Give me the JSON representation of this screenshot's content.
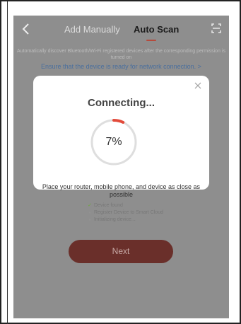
{
  "header": {
    "back_icon": "chevron-left",
    "tab_manual": "Add Manually",
    "tab_auto": "Auto Scan",
    "scan_icon": "scan-frame"
  },
  "main": {
    "description": "Automatically discover Bluetooth/Wi-Fi registered devices after the corresponding permission is turned on",
    "ensure_link": "Ensure that the device is ready for network connection. >",
    "next_label": "Next"
  },
  "modal": {
    "title": "Connecting...",
    "percent_text": "7%",
    "progress_fraction": 0.07,
    "message": "Place your router, mobile phone, and device as close as possible",
    "steps": [
      {
        "label": "Device found",
        "status": "done",
        "icon": "check"
      },
      {
        "label": "Register Device to Smart Cloud",
        "status": "pending",
        "icon": "bullet"
      },
      {
        "label": "Initializing device...",
        "status": "pending",
        "icon": "bullet"
      }
    ],
    "close_icon": "close"
  },
  "colors": {
    "overlay": "#8e8e8e",
    "accent": "#b54a3c",
    "link": "#4a6f9e",
    "success": "#6cab3b",
    "next_button": "#6a2f2a"
  }
}
